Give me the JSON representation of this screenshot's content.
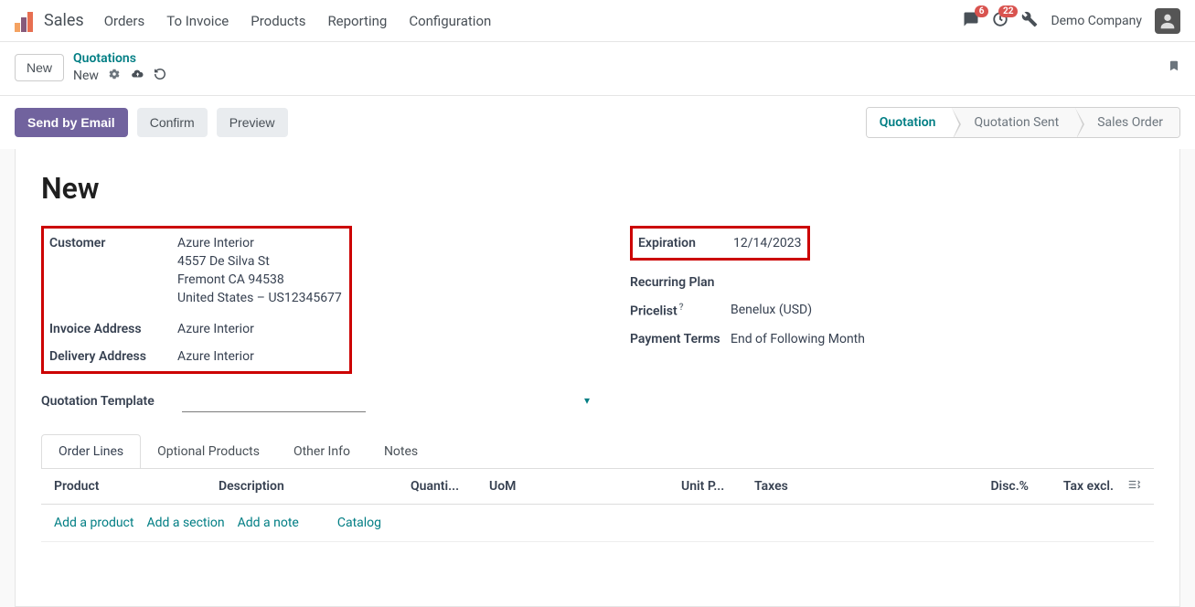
{
  "app": {
    "name": "Sales"
  },
  "nav": [
    "Orders",
    "To Invoice",
    "Products",
    "Reporting",
    "Configuration"
  ],
  "topbar": {
    "msg_badge": "6",
    "clock_badge": "22",
    "company": "Demo Company"
  },
  "breadcrumb": {
    "root": "Quotations",
    "current": "New",
    "new_button": "New"
  },
  "actions": {
    "send": "Send by Email",
    "confirm": "Confirm",
    "preview": "Preview"
  },
  "status": [
    "Quotation",
    "Quotation Sent",
    "Sales Order"
  ],
  "title": "New",
  "left": {
    "customer_label": "Customer",
    "customer": {
      "name": "Azure Interior",
      "street": "4557 De Silva St",
      "city": "Fremont CA 94538",
      "country": "United States – US12345677"
    },
    "invoice_label": "Invoice Address",
    "invoice_value": "Azure Interior",
    "delivery_label": "Delivery Address",
    "delivery_value": "Azure Interior",
    "template_label": "Quotation Template"
  },
  "right": {
    "exp_label": "Expiration",
    "exp_value": "12/14/2023",
    "recurring_label": "Recurring Plan",
    "pricelist_label": "Pricelist",
    "pricelist_value": "Benelux (USD)",
    "terms_label": "Payment Terms",
    "terms_value": "End of Following Month"
  },
  "tabs": [
    "Order Lines",
    "Optional Products",
    "Other Info",
    "Notes"
  ],
  "grid": {
    "headers": {
      "product": "Product",
      "desc": "Description",
      "qty": "Quanti...",
      "uom": "UoM",
      "price": "Unit P...",
      "taxes": "Taxes",
      "disc": "Disc.%",
      "taxexcl": "Tax excl."
    },
    "add_product": "Add a product",
    "add_section": "Add a section",
    "add_note": "Add a note",
    "catalog": "Catalog"
  }
}
